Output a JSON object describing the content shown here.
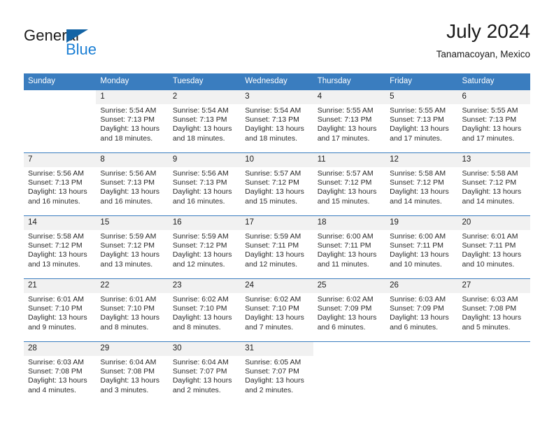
{
  "brand": {
    "name_part1": "General",
    "name_part2": "Blue",
    "triangle_icon": "triangle-icon",
    "colors": {
      "dark": "#1b1b1b",
      "blue": "#1b7fd4",
      "triangle": "#1464a5"
    }
  },
  "header": {
    "title": "July 2024",
    "subtitle": "Tanamacoyan, Mexico"
  },
  "calendar": {
    "header_bg": "#3a7dbf",
    "daynum_bg": "#f1f1f1",
    "weekdays": [
      "Sunday",
      "Monday",
      "Tuesday",
      "Wednesday",
      "Thursday",
      "Friday",
      "Saturday"
    ],
    "weeks": [
      [
        {
          "day": "",
          "sunrise": "",
          "sunset": "",
          "daylight1": "",
          "daylight2": "",
          "empty": true
        },
        {
          "day": "1",
          "sunrise": "Sunrise: 5:54 AM",
          "sunset": "Sunset: 7:13 PM",
          "daylight1": "Daylight: 13 hours",
          "daylight2": "and 18 minutes."
        },
        {
          "day": "2",
          "sunrise": "Sunrise: 5:54 AM",
          "sunset": "Sunset: 7:13 PM",
          "daylight1": "Daylight: 13 hours",
          "daylight2": "and 18 minutes."
        },
        {
          "day": "3",
          "sunrise": "Sunrise: 5:54 AM",
          "sunset": "Sunset: 7:13 PM",
          "daylight1": "Daylight: 13 hours",
          "daylight2": "and 18 minutes."
        },
        {
          "day": "4",
          "sunrise": "Sunrise: 5:55 AM",
          "sunset": "Sunset: 7:13 PM",
          "daylight1": "Daylight: 13 hours",
          "daylight2": "and 17 minutes."
        },
        {
          "day": "5",
          "sunrise": "Sunrise: 5:55 AM",
          "sunset": "Sunset: 7:13 PM",
          "daylight1": "Daylight: 13 hours",
          "daylight2": "and 17 minutes."
        },
        {
          "day": "6",
          "sunrise": "Sunrise: 5:55 AM",
          "sunset": "Sunset: 7:13 PM",
          "daylight1": "Daylight: 13 hours",
          "daylight2": "and 17 minutes."
        }
      ],
      [
        {
          "day": "7",
          "sunrise": "Sunrise: 5:56 AM",
          "sunset": "Sunset: 7:13 PM",
          "daylight1": "Daylight: 13 hours",
          "daylight2": "and 16 minutes."
        },
        {
          "day": "8",
          "sunrise": "Sunrise: 5:56 AM",
          "sunset": "Sunset: 7:13 PM",
          "daylight1": "Daylight: 13 hours",
          "daylight2": "and 16 minutes."
        },
        {
          "day": "9",
          "sunrise": "Sunrise: 5:56 AM",
          "sunset": "Sunset: 7:13 PM",
          "daylight1": "Daylight: 13 hours",
          "daylight2": "and 16 minutes."
        },
        {
          "day": "10",
          "sunrise": "Sunrise: 5:57 AM",
          "sunset": "Sunset: 7:12 PM",
          "daylight1": "Daylight: 13 hours",
          "daylight2": "and 15 minutes."
        },
        {
          "day": "11",
          "sunrise": "Sunrise: 5:57 AM",
          "sunset": "Sunset: 7:12 PM",
          "daylight1": "Daylight: 13 hours",
          "daylight2": "and 15 minutes."
        },
        {
          "day": "12",
          "sunrise": "Sunrise: 5:58 AM",
          "sunset": "Sunset: 7:12 PM",
          "daylight1": "Daylight: 13 hours",
          "daylight2": "and 14 minutes."
        },
        {
          "day": "13",
          "sunrise": "Sunrise: 5:58 AM",
          "sunset": "Sunset: 7:12 PM",
          "daylight1": "Daylight: 13 hours",
          "daylight2": "and 14 minutes."
        }
      ],
      [
        {
          "day": "14",
          "sunrise": "Sunrise: 5:58 AM",
          "sunset": "Sunset: 7:12 PM",
          "daylight1": "Daylight: 13 hours",
          "daylight2": "and 13 minutes."
        },
        {
          "day": "15",
          "sunrise": "Sunrise: 5:59 AM",
          "sunset": "Sunset: 7:12 PM",
          "daylight1": "Daylight: 13 hours",
          "daylight2": "and 13 minutes."
        },
        {
          "day": "16",
          "sunrise": "Sunrise: 5:59 AM",
          "sunset": "Sunset: 7:12 PM",
          "daylight1": "Daylight: 13 hours",
          "daylight2": "and 12 minutes."
        },
        {
          "day": "17",
          "sunrise": "Sunrise: 5:59 AM",
          "sunset": "Sunset: 7:11 PM",
          "daylight1": "Daylight: 13 hours",
          "daylight2": "and 12 minutes."
        },
        {
          "day": "18",
          "sunrise": "Sunrise: 6:00 AM",
          "sunset": "Sunset: 7:11 PM",
          "daylight1": "Daylight: 13 hours",
          "daylight2": "and 11 minutes."
        },
        {
          "day": "19",
          "sunrise": "Sunrise: 6:00 AM",
          "sunset": "Sunset: 7:11 PM",
          "daylight1": "Daylight: 13 hours",
          "daylight2": "and 10 minutes."
        },
        {
          "day": "20",
          "sunrise": "Sunrise: 6:01 AM",
          "sunset": "Sunset: 7:11 PM",
          "daylight1": "Daylight: 13 hours",
          "daylight2": "and 10 minutes."
        }
      ],
      [
        {
          "day": "21",
          "sunrise": "Sunrise: 6:01 AM",
          "sunset": "Sunset: 7:10 PM",
          "daylight1": "Daylight: 13 hours",
          "daylight2": "and 9 minutes."
        },
        {
          "day": "22",
          "sunrise": "Sunrise: 6:01 AM",
          "sunset": "Sunset: 7:10 PM",
          "daylight1": "Daylight: 13 hours",
          "daylight2": "and 8 minutes."
        },
        {
          "day": "23",
          "sunrise": "Sunrise: 6:02 AM",
          "sunset": "Sunset: 7:10 PM",
          "daylight1": "Daylight: 13 hours",
          "daylight2": "and 8 minutes."
        },
        {
          "day": "24",
          "sunrise": "Sunrise: 6:02 AM",
          "sunset": "Sunset: 7:10 PM",
          "daylight1": "Daylight: 13 hours",
          "daylight2": "and 7 minutes."
        },
        {
          "day": "25",
          "sunrise": "Sunrise: 6:02 AM",
          "sunset": "Sunset: 7:09 PM",
          "daylight1": "Daylight: 13 hours",
          "daylight2": "and 6 minutes."
        },
        {
          "day": "26",
          "sunrise": "Sunrise: 6:03 AM",
          "sunset": "Sunset: 7:09 PM",
          "daylight1": "Daylight: 13 hours",
          "daylight2": "and 6 minutes."
        },
        {
          "day": "27",
          "sunrise": "Sunrise: 6:03 AM",
          "sunset": "Sunset: 7:08 PM",
          "daylight1": "Daylight: 13 hours",
          "daylight2": "and 5 minutes."
        }
      ],
      [
        {
          "day": "28",
          "sunrise": "Sunrise: 6:03 AM",
          "sunset": "Sunset: 7:08 PM",
          "daylight1": "Daylight: 13 hours",
          "daylight2": "and 4 minutes."
        },
        {
          "day": "29",
          "sunrise": "Sunrise: 6:04 AM",
          "sunset": "Sunset: 7:08 PM",
          "daylight1": "Daylight: 13 hours",
          "daylight2": "and 3 minutes."
        },
        {
          "day": "30",
          "sunrise": "Sunrise: 6:04 AM",
          "sunset": "Sunset: 7:07 PM",
          "daylight1": "Daylight: 13 hours",
          "daylight2": "and 2 minutes."
        },
        {
          "day": "31",
          "sunrise": "Sunrise: 6:05 AM",
          "sunset": "Sunset: 7:07 PM",
          "daylight1": "Daylight: 13 hours",
          "daylight2": "and 2 minutes."
        },
        {
          "day": "",
          "sunrise": "",
          "sunset": "",
          "daylight1": "",
          "daylight2": "",
          "empty": true
        },
        {
          "day": "",
          "sunrise": "",
          "sunset": "",
          "daylight1": "",
          "daylight2": "",
          "empty": true
        },
        {
          "day": "",
          "sunrise": "",
          "sunset": "",
          "daylight1": "",
          "daylight2": "",
          "empty": true
        }
      ]
    ]
  }
}
